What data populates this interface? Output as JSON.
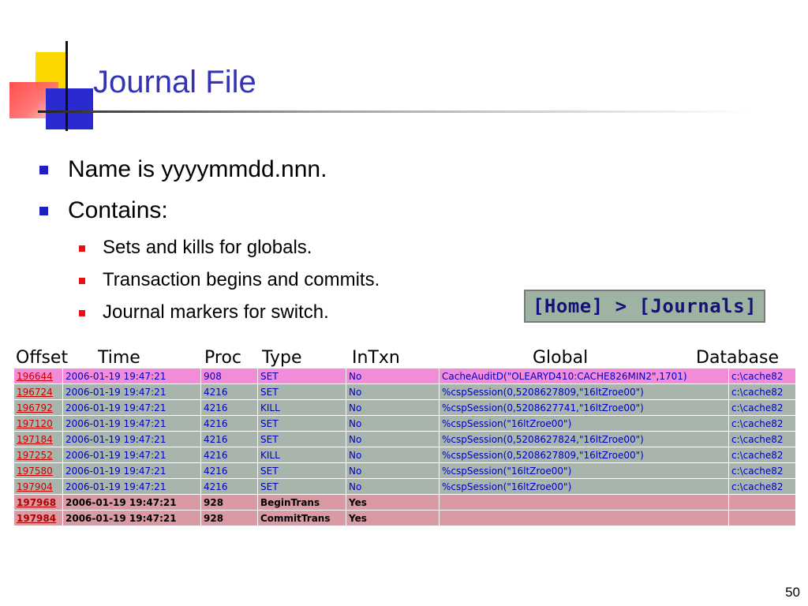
{
  "slide": {
    "title": "Journal File",
    "page_number": "50"
  },
  "bullets": {
    "level1": [
      "Name is yyyymmdd.nnn.",
      "Contains:"
    ],
    "level2": [
      "Sets and kills for globals.",
      "Transaction begins and commits.",
      "Journal markers for switch."
    ]
  },
  "breadcrumb": {
    "home": "[Home]",
    "separator": " > ",
    "journals": "[Journals]"
  },
  "table": {
    "headers": [
      "Offset",
      "Time",
      "Proc",
      "Type",
      "InTxn",
      "Global",
      "Database"
    ],
    "rows": [
      {
        "offset": "196644",
        "time": "2006-01-19 19:47:21",
        "proc": "908",
        "type": "SET",
        "intxn": "No",
        "global": "CacheAuditD(\"OLEARYD410:CACHE826MIN2\",1701)",
        "database": "c:\\cache82"
      },
      {
        "offset": "196724",
        "time": "2006-01-19 19:47:21",
        "proc": "4216",
        "type": "SET",
        "intxn": "No",
        "global": "%cspSession(0,5208627809,\"16ltZroe00\")",
        "database": "c:\\cache82"
      },
      {
        "offset": "196792",
        "time": "2006-01-19 19:47:21",
        "proc": "4216",
        "type": "KILL",
        "intxn": "No",
        "global": "%cspSession(0,5208627741,\"16ltZroe00\")",
        "database": "c:\\cache82"
      },
      {
        "offset": "197120",
        "time": "2006-01-19 19:47:21",
        "proc": "4216",
        "type": "SET",
        "intxn": "No",
        "global": "%cspSession(\"16ltZroe00\")",
        "database": "c:\\cache82"
      },
      {
        "offset": "197184",
        "time": "2006-01-19 19:47:21",
        "proc": "4216",
        "type": "SET",
        "intxn": "No",
        "global": "%cspSession(0,5208627824,\"16ltZroe00\")",
        "database": "c:\\cache82"
      },
      {
        "offset": "197252",
        "time": "2006-01-19 19:47:21",
        "proc": "4216",
        "type": "KILL",
        "intxn": "No",
        "global": "%cspSession(0,5208627809,\"16ltZroe00\")",
        "database": "c:\\cache82"
      },
      {
        "offset": "197580",
        "time": "2006-01-19 19:47:21",
        "proc": "4216",
        "type": "SET",
        "intxn": "No",
        "global": "%cspSession(\"16ltZroe00\")",
        "database": "c:\\cache82"
      },
      {
        "offset": "197904",
        "time": "2006-01-19 19:47:21",
        "proc": "4216",
        "type": "SET",
        "intxn": "No",
        "global": "%cspSession(\"16ltZroe00\")",
        "database": "c:\\cache82"
      },
      {
        "offset": "197968",
        "time": "2006-01-19 19:47:21",
        "proc": "928",
        "type": "BeginTrans",
        "intxn": "Yes",
        "global": "",
        "database": ""
      },
      {
        "offset": "197984",
        "time": "2006-01-19 19:47:21",
        "proc": "928",
        "type": "CommitTrans",
        "intxn": "Yes",
        "global": "",
        "database": ""
      }
    ]
  },
  "colors": {
    "title": "#3333b3",
    "row_first": "#f28cd9",
    "row_normal": "#a7b5ad",
    "row_transaction": "#d99aa3",
    "offset_link": "#cc0000"
  }
}
